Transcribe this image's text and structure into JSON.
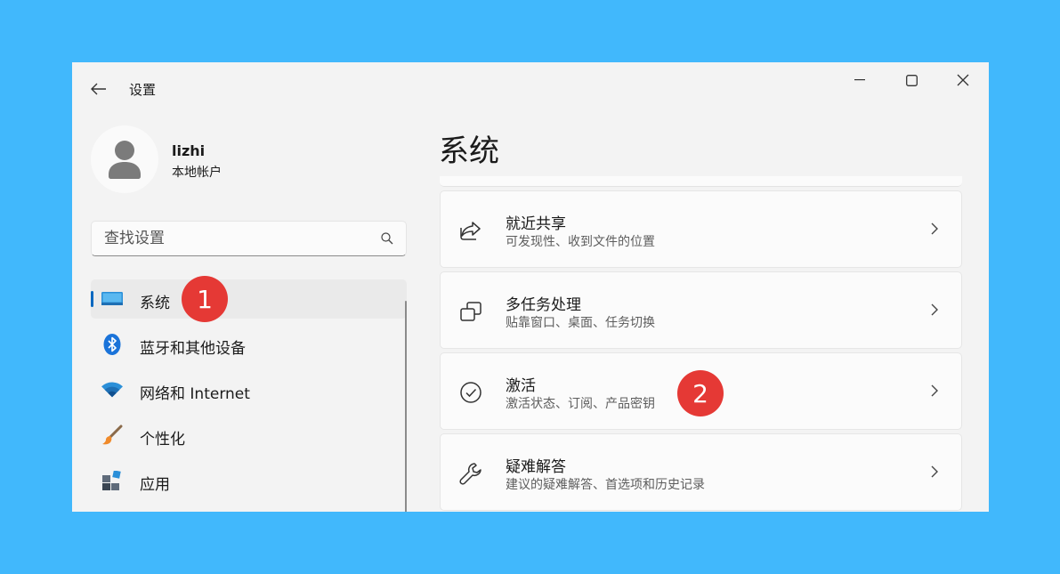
{
  "window": {
    "title": "设置"
  },
  "profile": {
    "name": "lizhi",
    "account_type": "本地帐户"
  },
  "search": {
    "placeholder": "查找设置"
  },
  "sidebar": {
    "items": [
      {
        "label": "系统",
        "icon": "display-icon",
        "selected": true
      },
      {
        "label": "蓝牙和其他设备",
        "icon": "bluetooth-icon",
        "selected": false
      },
      {
        "label": "网络和 Internet",
        "icon": "wifi-icon",
        "selected": false
      },
      {
        "label": "个性化",
        "icon": "brush-icon",
        "selected": false
      },
      {
        "label": "应用",
        "icon": "apps-icon",
        "selected": false
      }
    ]
  },
  "main": {
    "title": "系统",
    "cards": [
      {
        "title": "就近共享",
        "subtitle": "可发现性、收到文件的位置",
        "icon": "share-icon"
      },
      {
        "title": "多任务处理",
        "subtitle": "贴靠窗口、桌面、任务切换",
        "icon": "multitask-icon"
      },
      {
        "title": "激活",
        "subtitle": "激活状态、订阅、产品密钥",
        "icon": "check-circle-icon"
      },
      {
        "title": "疑难解答",
        "subtitle": "建议的疑难解答、首选项和历史记录",
        "icon": "wrench-icon"
      }
    ]
  },
  "annotations": {
    "step1": "1",
    "step2": "2"
  },
  "colors": {
    "background": "#41b8fc",
    "accent": "#0067c0",
    "badge": "#e53935"
  }
}
